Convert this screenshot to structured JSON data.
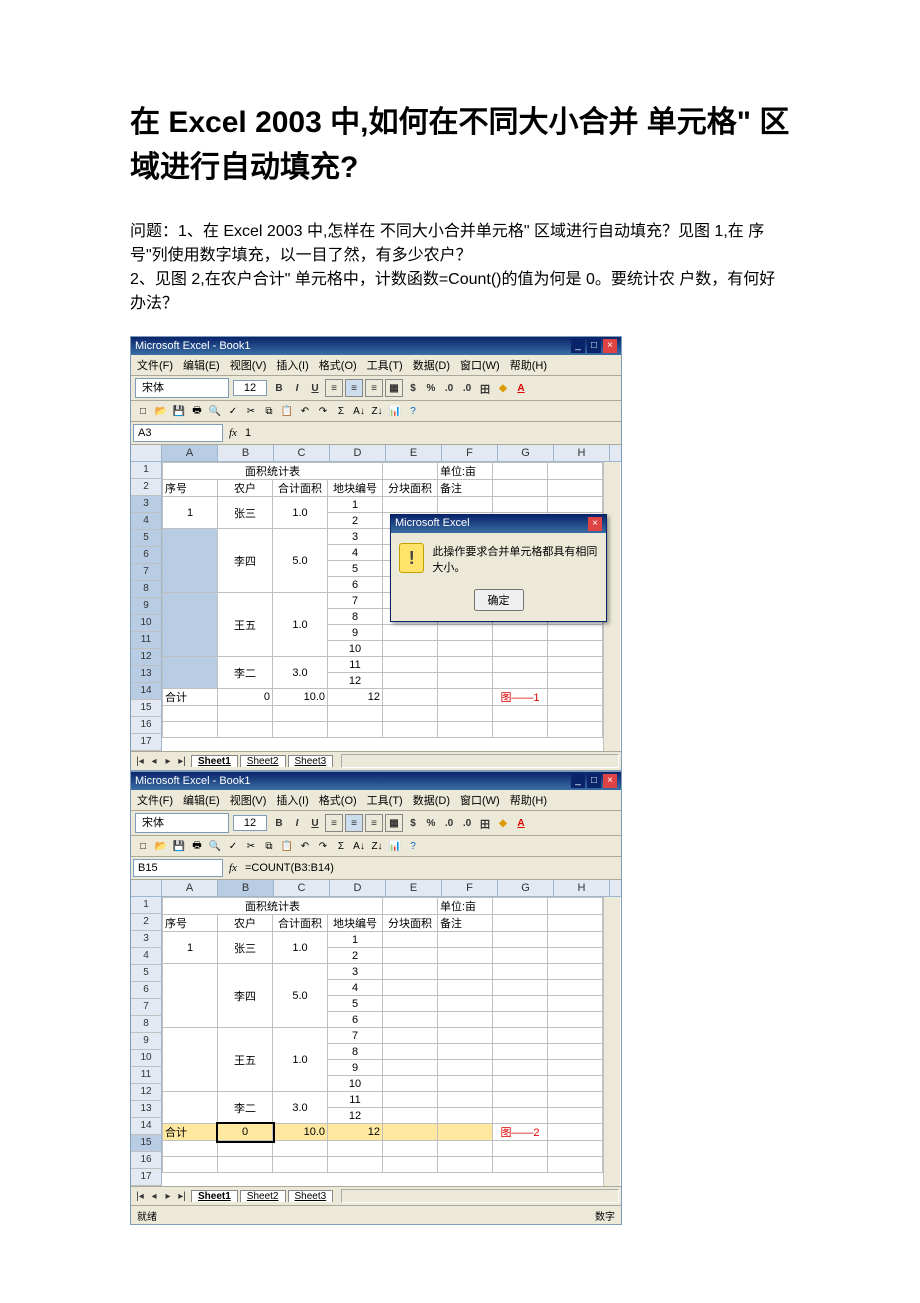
{
  "article": {
    "title": "在 Excel 2003 中,如何在不同大小合并 单元格\" 区域进行自动填充?",
    "p1": "问题：1、在 Excel 2003 中,怎样在 不同大小合并单元格\" 区域进行自动填充？见图 1,在 序号\"列使用数字填充，以一目了然，有多少农户？",
    "p2": "2、见图 2,在农户合计\" 单元格中，计数函数=Count()的值为何是 0。要统计农 户数，有何好办法？"
  },
  "common": {
    "app_title": "Microsoft Excel - Book1",
    "menus": [
      "文件(F)",
      "编辑(E)",
      "视图(V)",
      "插入(I)",
      "格式(O)",
      "工具(T)",
      "数据(D)",
      "窗口(W)",
      "帮助(H)"
    ],
    "font_name": "宋体",
    "font_size": "12",
    "cols": [
      "A",
      "B",
      "C",
      "D",
      "E",
      "F",
      "G",
      "H"
    ],
    "rows": [
      "1",
      "2",
      "3",
      "4",
      "5",
      "6",
      "7",
      "8",
      "9",
      "10",
      "11",
      "12",
      "13",
      "14",
      "15",
      "16",
      "17"
    ],
    "tabs": [
      "Sheet1",
      "Sheet2",
      "Sheet3"
    ],
    "table": {
      "title": "面积统计表",
      "unit": "单位:亩",
      "headers": [
        "序号",
        "农户",
        "合计面积",
        "地块编号",
        "分块面积",
        "备注"
      ],
      "data_rows": [
        {
          "seq": "1",
          "name": "张三",
          "area": "1.0",
          "blocks": [
            "1",
            "2"
          ]
        },
        {
          "seq": "",
          "name": "李四",
          "area": "5.0",
          "blocks": [
            "3",
            "4",
            "5",
            "6"
          ]
        },
        {
          "seq": "",
          "name": "王五",
          "area": "1.0",
          "blocks": [
            "7",
            "8",
            "9",
            "10"
          ]
        },
        {
          "seq": "",
          "name": "李二",
          "area": "3.0",
          "blocks": [
            "11",
            "12"
          ]
        }
      ],
      "total_label": "合计",
      "total_b": "0",
      "total_c": "10.0",
      "total_d": "12"
    }
  },
  "fig1": {
    "namebox": "A3",
    "formula": "1",
    "selected_col": "A",
    "dialog_title": "Microsoft Excel",
    "dialog_msg": "此操作要求合并单元格都具有相同大小。",
    "dialog_ok": "确定",
    "label": "图——1"
  },
  "fig2": {
    "namebox": "B15",
    "formula": "=COUNT(B3:B14)",
    "selected_col": "B",
    "status_left": "就绪",
    "status_right": "数字",
    "label": "图——2"
  },
  "chart_data": {
    "type": "table",
    "title": "面积统计表",
    "unit": "亩",
    "columns": [
      "序号",
      "农户",
      "合计面积",
      "地块编号",
      "分块面积",
      "备注"
    ],
    "rows": [
      [
        "1",
        "张三",
        1.0,
        1,
        null,
        null
      ],
      [
        "1",
        "张三",
        1.0,
        2,
        null,
        null
      ],
      [
        "",
        "李四",
        5.0,
        3,
        null,
        null
      ],
      [
        "",
        "李四",
        5.0,
        4,
        null,
        null
      ],
      [
        "",
        "李四",
        5.0,
        5,
        null,
        null
      ],
      [
        "",
        "李四",
        5.0,
        6,
        null,
        null
      ],
      [
        "",
        "王五",
        1.0,
        7,
        null,
        null
      ],
      [
        "",
        "王五",
        1.0,
        8,
        null,
        null
      ],
      [
        "",
        "王五",
        1.0,
        9,
        null,
        null
      ],
      [
        "",
        "王五",
        1.0,
        10,
        null,
        null
      ],
      [
        "",
        "李二",
        3.0,
        11,
        null,
        null
      ],
      [
        "",
        "李二",
        3.0,
        12,
        null,
        null
      ]
    ],
    "totals": {
      "农户": 0,
      "合计面积": 10.0,
      "地块编号": 12
    }
  }
}
